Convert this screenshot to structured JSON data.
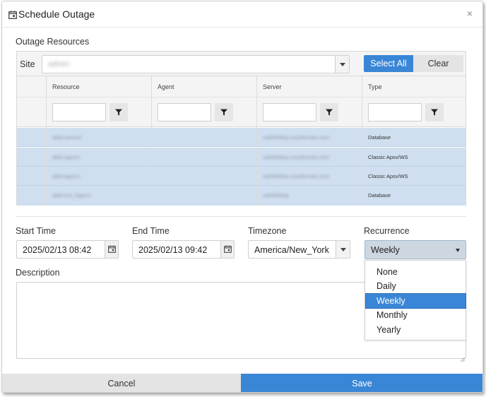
{
  "dialog": {
    "title": "Schedule Outage",
    "close_label": "×",
    "title_icon": "calendar-icon",
    "close_icon": "close-icon"
  },
  "resources": {
    "section_label": "Outage Resources",
    "site_label": "Site",
    "site_value": "admin",
    "select_all_label": "Select All",
    "clear_label": "Clear",
    "columns": [
      "Resource",
      "Agent",
      "Server",
      "Type"
    ],
    "filter_icon": "filter-icon",
    "rows": [
      {
        "resource": "abld-samuel",
        "agent": "",
        "server": "ca0069dsp.corpdomain.com",
        "type": "Database"
      },
      {
        "resource": "abld-appsrv",
        "agent": "",
        "server": "ca0069dsp.corpdomain.com",
        "type": "Classic Apsv/WS"
      },
      {
        "resource": "abld-appsrv",
        "agent": "",
        "server": "ca0069dsp.corpdomain.com",
        "type": "Classic Apsv/WS"
      },
      {
        "resource": "abld-ocs_bigsrvr",
        "agent": "",
        "server": "ca0069dsp",
        "type": "Database"
      }
    ]
  },
  "schedule": {
    "start_label": "Start Time",
    "start_value": "2025/02/13 08:42",
    "end_label": "End Time",
    "end_value": "2025/02/13 09:42",
    "timezone_label": "Timezone",
    "timezone_value": "America/New_York",
    "recurrence_label": "Recurrence",
    "recurrence_value": "Weekly",
    "recurrence_options": [
      "None",
      "Daily",
      "Weekly",
      "Monthly",
      "Yearly"
    ],
    "calendar_icon": "calendar-icon"
  },
  "description": {
    "label": "Description",
    "value": ""
  },
  "footer": {
    "cancel_label": "Cancel",
    "save_label": "Save"
  },
  "colors": {
    "accent": "#3a86d6",
    "selected_row": "#cfdff0",
    "header_bg": "#f4f4f4",
    "secondary_button": "#e4e4e4"
  }
}
